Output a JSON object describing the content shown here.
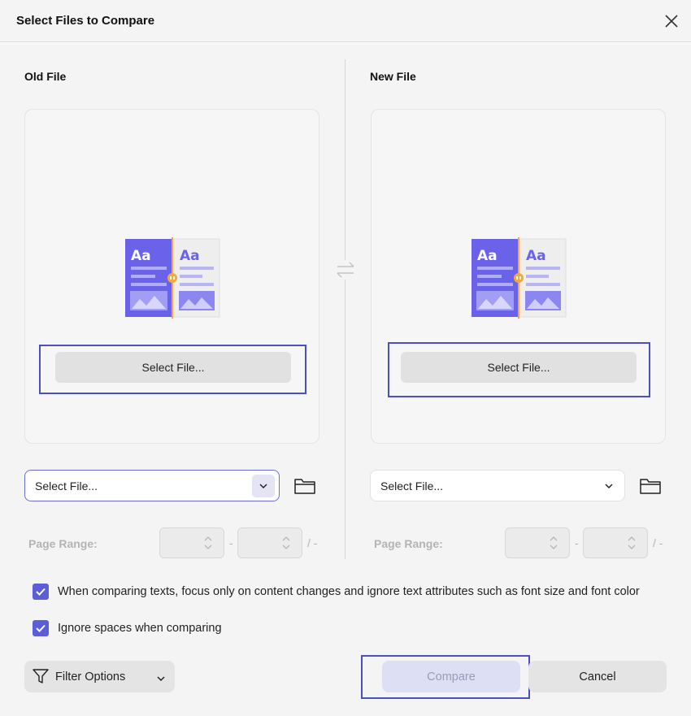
{
  "dialog": {
    "title": "Select Files to Compare",
    "close_icon": "close-icon"
  },
  "old_file": {
    "label": "Old File",
    "select_button": "Select File...",
    "combo_value": "Select File...",
    "page_range_label": "Page Range:",
    "range_dash": "-",
    "range_slash": "/ -"
  },
  "new_file": {
    "label": "New File",
    "select_button": "Select File...",
    "combo_value": "Select File...",
    "page_range_label": "Page Range:",
    "range_dash": "-",
    "range_slash": "/ -"
  },
  "options": {
    "focus_content": {
      "label": "When comparing texts, focus only on content changes and ignore text attributes such as font size and font color",
      "checked": true
    },
    "ignore_spaces": {
      "label": "Ignore spaces when comparing",
      "checked": true
    }
  },
  "footer": {
    "filter_label": "Filter Options",
    "compare_label": "Compare",
    "cancel_label": "Cancel"
  },
  "colors": {
    "accent": "#5b5ed6",
    "focus_outline": "#4b4fc4",
    "illustration_primary": "#6a63ea",
    "illustration_divider": "#f2a93b"
  }
}
